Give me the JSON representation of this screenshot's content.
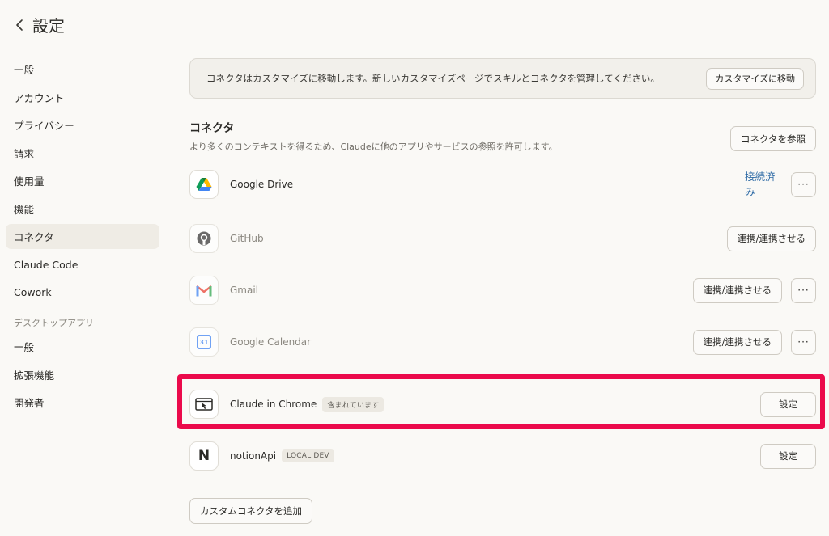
{
  "header": {
    "title": "設定"
  },
  "sidebar": {
    "items": [
      {
        "label": "一般"
      },
      {
        "label": "アカウント"
      },
      {
        "label": "プライバシー"
      },
      {
        "label": "請求"
      },
      {
        "label": "使用量"
      },
      {
        "label": "機能"
      },
      {
        "label": "コネクタ"
      },
      {
        "label": "Claude Code"
      },
      {
        "label": "Cowork"
      }
    ],
    "section_label": "デスクトップアプリ",
    "desktop_items": [
      {
        "label": "一般"
      },
      {
        "label": "拡張機能"
      },
      {
        "label": "開発者"
      }
    ]
  },
  "notice": {
    "text": "コネクタはカスタマイズに移動します。新しいカスタマイズページでスキルとコネクタを管理してください。",
    "button": "カスタマイズに移動"
  },
  "connectors_section": {
    "title": "コネクタ",
    "description": "より多くのコンテキストを得るため、Claudeに他のアプリやサービスの参照を許可します。",
    "browse_button": "コネクタを参照"
  },
  "connectors": [
    {
      "name": "Google Drive",
      "status": "接続済み",
      "more": "···"
    },
    {
      "name": "GitHub",
      "action": "連携/連携させる"
    },
    {
      "name": "Gmail",
      "action": "連携/連携させる",
      "more": "···"
    },
    {
      "name": "Google Calendar",
      "action": "連携/連携させる",
      "more": "···",
      "icon_text": "31"
    },
    {
      "name": "Claude in Chrome",
      "badge": "含まれています",
      "action": "設定"
    },
    {
      "name": "notionApi",
      "badge": "LOCAL DEV",
      "action": "設定",
      "icon_text": "N"
    }
  ],
  "add_button": "カスタムコネクタを追加",
  "colors": {
    "highlight": "#eb0a4b",
    "link": "#2d6aa5",
    "active_bg": "#efece5"
  }
}
